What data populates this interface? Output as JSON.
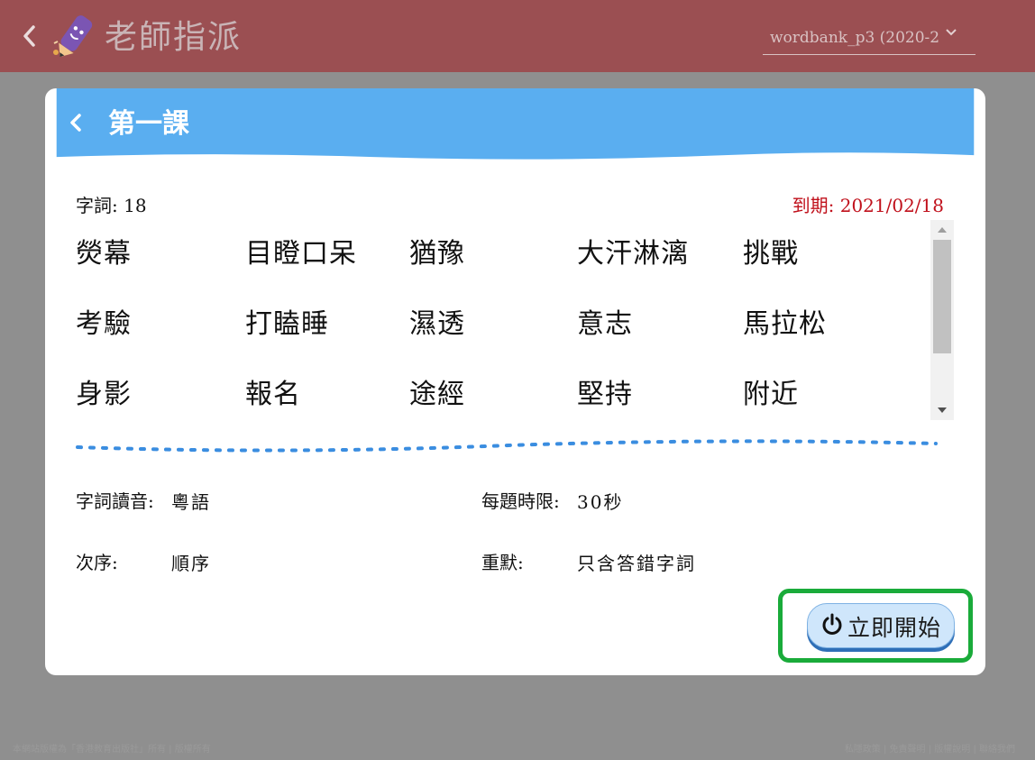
{
  "app": {
    "title": "老師指派",
    "wordbank_select": "wordbank_p3 (2020-2"
  },
  "modal": {
    "lesson_title": "第一課",
    "word_count_label": "字詞: 18",
    "due_label": "到期: 2021/02/18",
    "words": [
      "熒幕",
      "目瞪口呆",
      "猶豫",
      "大汗淋漓",
      "挑戰",
      "考驗",
      "打瞌睡",
      "濕透",
      "意志",
      "馬拉松",
      "身影",
      "報名",
      "途經",
      "堅持",
      "附近"
    ],
    "settings": {
      "pronunciation_label": "字詞讀音:",
      "pronunciation_value": "粵語",
      "time_limit_label": "每題時限:",
      "time_limit_value": "30秒",
      "order_label": "次序:",
      "order_value": "順序",
      "retry_label": "重默:",
      "retry_value": "只含答錯字詞"
    },
    "start_button": "立即開始"
  },
  "footer": {
    "left": "本網站版權為「香港教育出版社」所有 | 版權所有",
    "right": "私隱政策 | 免責聲明 | 版權說明 | 聯絡我們"
  },
  "colors": {
    "topbar": "#9b4f52",
    "modal_header": "#5aaef0",
    "due": "#c0101b",
    "highlight": "#1aab3a"
  }
}
